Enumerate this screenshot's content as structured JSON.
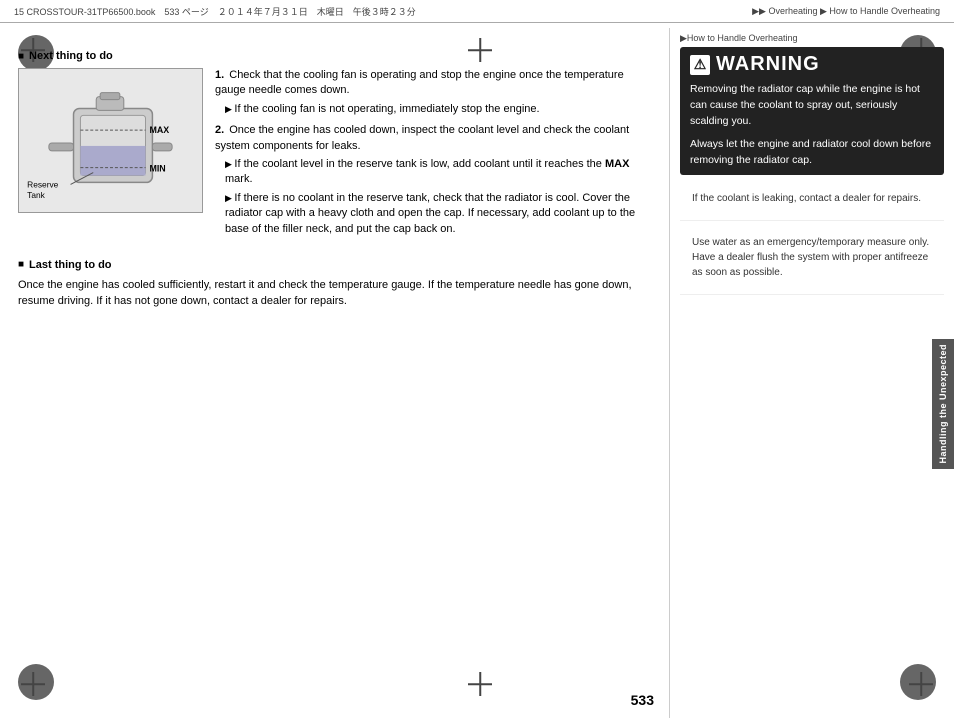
{
  "page": {
    "number": "533",
    "file_info": "15 CROSSTOUR-31TP66500.book　533 ページ　２０１４年７月３１日　木曜日　午後３時２３分"
  },
  "header": {
    "breadcrumb": "▶▶ Overheating ▶ How to Handle Overheating"
  },
  "left": {
    "next_section_title": "Next thing to do",
    "image_labels": {
      "max": "MAX",
      "min": "MIN",
      "reserve": "Reserve",
      "tank": "Tank"
    },
    "steps": [
      {
        "num": "1.",
        "text": "Check that the cooling fan is operating and stop the engine once the temperature gauge needle comes down.",
        "sub": [
          "If the cooling fan is not operating, immediately stop the engine."
        ]
      },
      {
        "num": "2.",
        "text": "Once the engine has cooled down, inspect the coolant level and check the coolant system components for leaks.",
        "sub": [
          "If the coolant level in the reserve tank is low, add coolant until it reaches the MAX mark.",
          "If there is no coolant in the reserve tank, check that the radiator is cool. Cover the radiator cap with a heavy cloth and open the cap. If necessary, add coolant up to the base of the filler neck, and put the cap back on."
        ]
      }
    ],
    "max_bold": "MAX",
    "last_section_title": "Last thing to do",
    "last_section_text": "Once the engine has cooled sufficiently, restart it and check the temperature gauge. If the temperature needle has gone down, resume driving. If it has not gone down, contact a dealer for repairs."
  },
  "right": {
    "warning_breadcrumb": "▶How to Handle Overheating",
    "warning_title": "WARNING",
    "warning_icon": "⚠",
    "warning_body": [
      "Removing the radiator cap while the engine is hot can cause the coolant to spray out, seriously scalding you.",
      "Always let the engine and radiator cool down before removing the radiator cap."
    ],
    "info1": "If the coolant is leaking, contact a dealer for repairs.",
    "info2": "Use water as an emergency/temporary measure only. Have a dealer flush the system with proper antifreeze as soon as possible.",
    "side_tab": "Handling the Unexpected"
  }
}
